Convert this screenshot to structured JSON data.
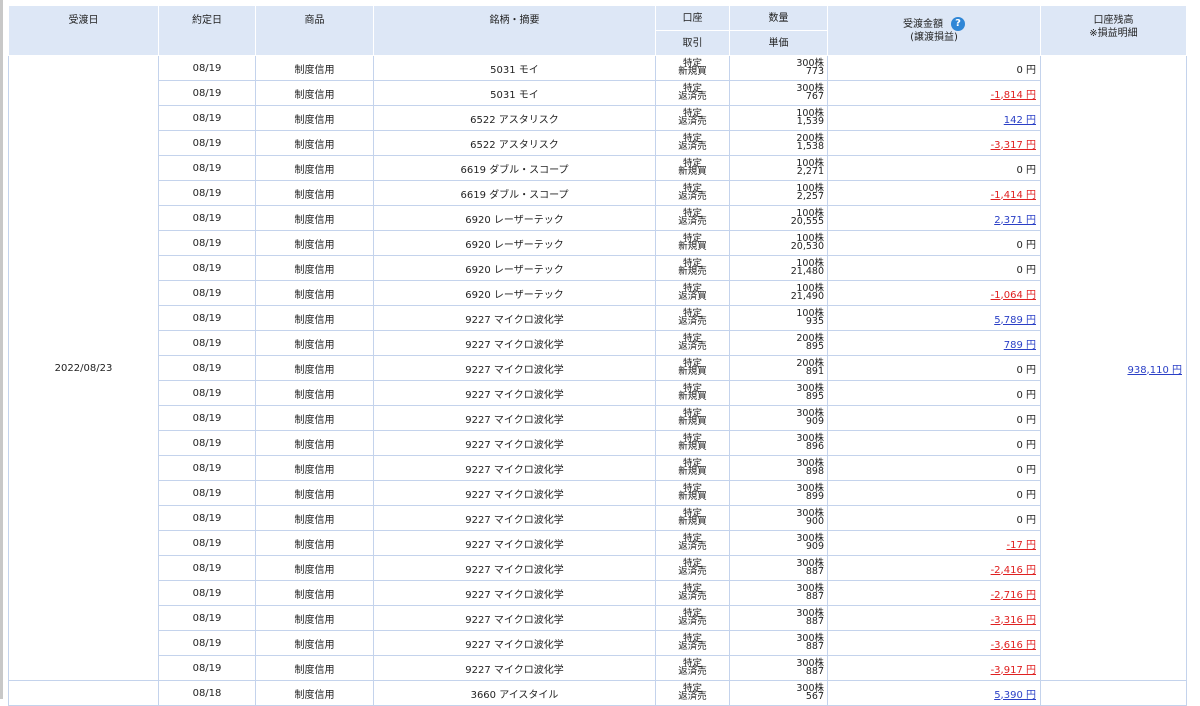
{
  "headers": {
    "settlement_date": "受渡日",
    "trade_date": "約定日",
    "product": "商品",
    "name_summary": "銘柄・摘要",
    "account": "口座",
    "trade": "取引",
    "quantity": "数量",
    "unit_price": "単価",
    "amount": "受渡金額",
    "pl_sub": "(譲渡損益)",
    "balance_line1": "口座残高",
    "balance_line2": "※損益明細"
  },
  "group_date": "2022/08/23",
  "group_balance": "938,110 円",
  "rows": [
    {
      "trade_date": "08/19",
      "product": "制度信用",
      "name": "5031 モイ",
      "account": "特定",
      "trade": "新規買",
      "qty": "300株",
      "price": "773",
      "amount": "0 円",
      "link": false,
      "neg": false
    },
    {
      "trade_date": "08/19",
      "product": "制度信用",
      "name": "5031 モイ",
      "account": "特定",
      "trade": "返済売",
      "qty": "300株",
      "price": "767",
      "amount": "-1,814 円",
      "link": true,
      "neg": true
    },
    {
      "trade_date": "08/19",
      "product": "制度信用",
      "name": "6522 アスタリスク",
      "account": "特定",
      "trade": "返済売",
      "qty": "100株",
      "price": "1,539",
      "amount": "142 円",
      "link": true,
      "neg": false
    },
    {
      "trade_date": "08/19",
      "product": "制度信用",
      "name": "6522 アスタリスク",
      "account": "特定",
      "trade": "返済売",
      "qty": "200株",
      "price": "1,538",
      "amount": "-3,317 円",
      "link": true,
      "neg": true
    },
    {
      "trade_date": "08/19",
      "product": "制度信用",
      "name": "6619 ダブル・スコープ",
      "account": "特定",
      "trade": "新規買",
      "qty": "100株",
      "price": "2,271",
      "amount": "0 円",
      "link": false,
      "neg": false
    },
    {
      "trade_date": "08/19",
      "product": "制度信用",
      "name": "6619 ダブル・スコープ",
      "account": "特定",
      "trade": "返済売",
      "qty": "100株",
      "price": "2,257",
      "amount": "-1,414 円",
      "link": true,
      "neg": true
    },
    {
      "trade_date": "08/19",
      "product": "制度信用",
      "name": "6920 レーザーテック",
      "account": "特定",
      "trade": "返済売",
      "qty": "100株",
      "price": "20,555",
      "amount": "2,371 円",
      "link": true,
      "neg": false
    },
    {
      "trade_date": "08/19",
      "product": "制度信用",
      "name": "6920 レーザーテック",
      "account": "特定",
      "trade": "新規買",
      "qty": "100株",
      "price": "20,530",
      "amount": "0 円",
      "link": false,
      "neg": false
    },
    {
      "trade_date": "08/19",
      "product": "制度信用",
      "name": "6920 レーザーテック",
      "account": "特定",
      "trade": "新規売",
      "qty": "100株",
      "price": "21,480",
      "amount": "0 円",
      "link": false,
      "neg": false
    },
    {
      "trade_date": "08/19",
      "product": "制度信用",
      "name": "6920 レーザーテック",
      "account": "特定",
      "trade": "返済買",
      "qty": "100株",
      "price": "21,490",
      "amount": "-1,064 円",
      "link": true,
      "neg": true
    },
    {
      "trade_date": "08/19",
      "product": "制度信用",
      "name": "9227 マイクロ波化学",
      "account": "特定",
      "trade": "返済売",
      "qty": "100株",
      "price": "935",
      "amount": "5,789 円",
      "link": true,
      "neg": false
    },
    {
      "trade_date": "08/19",
      "product": "制度信用",
      "name": "9227 マイクロ波化学",
      "account": "特定",
      "trade": "返済売",
      "qty": "200株",
      "price": "895",
      "amount": "789 円",
      "link": true,
      "neg": false
    },
    {
      "trade_date": "08/19",
      "product": "制度信用",
      "name": "9227 マイクロ波化学",
      "account": "特定",
      "trade": "新規買",
      "qty": "200株",
      "price": "891",
      "amount": "0 円",
      "link": false,
      "neg": false
    },
    {
      "trade_date": "08/19",
      "product": "制度信用",
      "name": "9227 マイクロ波化学",
      "account": "特定",
      "trade": "新規買",
      "qty": "300株",
      "price": "895",
      "amount": "0 円",
      "link": false,
      "neg": false
    },
    {
      "trade_date": "08/19",
      "product": "制度信用",
      "name": "9227 マイクロ波化学",
      "account": "特定",
      "trade": "新規買",
      "qty": "300株",
      "price": "909",
      "amount": "0 円",
      "link": false,
      "neg": false
    },
    {
      "trade_date": "08/19",
      "product": "制度信用",
      "name": "9227 マイクロ波化学",
      "account": "特定",
      "trade": "新規買",
      "qty": "300株",
      "price": "896",
      "amount": "0 円",
      "link": false,
      "neg": false
    },
    {
      "trade_date": "08/19",
      "product": "制度信用",
      "name": "9227 マイクロ波化学",
      "account": "特定",
      "trade": "新規買",
      "qty": "300株",
      "price": "898",
      "amount": "0 円",
      "link": false,
      "neg": false
    },
    {
      "trade_date": "08/19",
      "product": "制度信用",
      "name": "9227 マイクロ波化学",
      "account": "特定",
      "trade": "新規買",
      "qty": "300株",
      "price": "899",
      "amount": "0 円",
      "link": false,
      "neg": false
    },
    {
      "trade_date": "08/19",
      "product": "制度信用",
      "name": "9227 マイクロ波化学",
      "account": "特定",
      "trade": "新規買",
      "qty": "300株",
      "price": "900",
      "amount": "0 円",
      "link": false,
      "neg": false
    },
    {
      "trade_date": "08/19",
      "product": "制度信用",
      "name": "9227 マイクロ波化学",
      "account": "特定",
      "trade": "返済売",
      "qty": "300株",
      "price": "909",
      "amount": "-17 円",
      "link": true,
      "neg": true
    },
    {
      "trade_date": "08/19",
      "product": "制度信用",
      "name": "9227 マイクロ波化学",
      "account": "特定",
      "trade": "返済売",
      "qty": "300株",
      "price": "887",
      "amount": "-2,416 円",
      "link": true,
      "neg": true
    },
    {
      "trade_date": "08/19",
      "product": "制度信用",
      "name": "9227 マイクロ波化学",
      "account": "特定",
      "trade": "返済売",
      "qty": "300株",
      "price": "887",
      "amount": "-2,716 円",
      "link": true,
      "neg": true
    },
    {
      "trade_date": "08/19",
      "product": "制度信用",
      "name": "9227 マイクロ波化学",
      "account": "特定",
      "trade": "返済売",
      "qty": "300株",
      "price": "887",
      "amount": "-3,316 円",
      "link": true,
      "neg": true
    },
    {
      "trade_date": "08/19",
      "product": "制度信用",
      "name": "9227 マイクロ波化学",
      "account": "特定",
      "trade": "返済売",
      "qty": "300株",
      "price": "887",
      "amount": "-3,616 円",
      "link": true,
      "neg": true
    },
    {
      "trade_date": "08/19",
      "product": "制度信用",
      "name": "9227 マイクロ波化学",
      "account": "特定",
      "trade": "返済売",
      "qty": "300株",
      "price": "887",
      "amount": "-3,917 円",
      "link": true,
      "neg": true
    }
  ],
  "next_row": {
    "trade_date": "08/18",
    "product": "制度信用",
    "name": "3660 アイスタイル",
    "account": "特定",
    "trade": "返済売",
    "qty": "300株",
    "price": "567",
    "amount": "5,390 円",
    "link": true,
    "neg": false
  },
  "help_icon": "question-mark-help-icon"
}
